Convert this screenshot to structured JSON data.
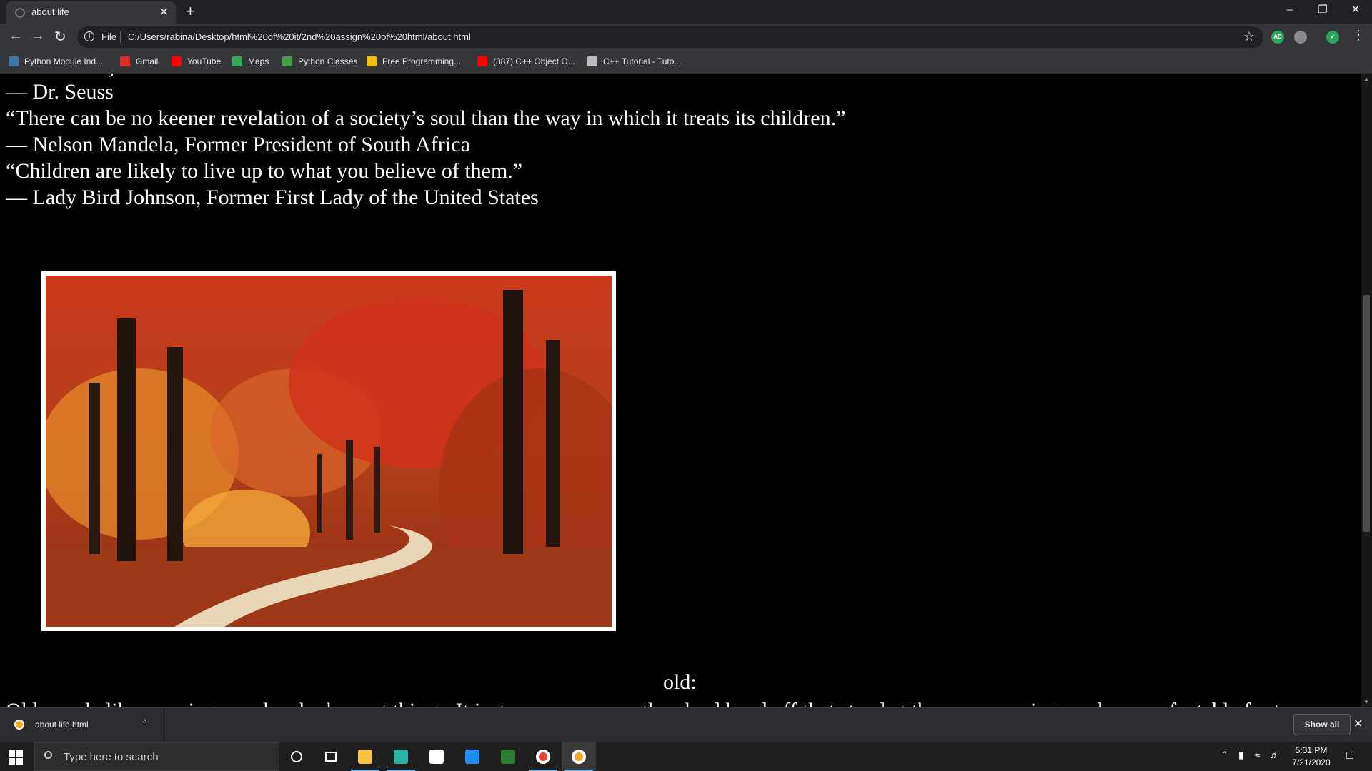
{
  "browser": {
    "tab_title": "about life",
    "new_tab_symbol": "+",
    "close_symbol": "✕",
    "scheme_label": "File",
    "url": "C:/Users/rabina/Desktop/html%20of%20it/2nd%20assign%20of%20html/about.html",
    "extensions": [
      {
        "name": "adblock-icon",
        "label": "AD",
        "color": "#2aa65c"
      },
      {
        "name": "drive-icon",
        "label": "",
        "color": "#8a8a8a"
      },
      {
        "name": "shield-check-icon",
        "label": "✓",
        "color": "#2aa65c"
      }
    ],
    "bookmarks": [
      {
        "label": "Python Module Ind...",
        "icon": "python-icon",
        "color": "#3b77a8"
      },
      {
        "label": "Gmail",
        "icon": "gmail-icon",
        "color": "#d93025"
      },
      {
        "label": "YouTube",
        "icon": "youtube-icon",
        "color": "#ff0000"
      },
      {
        "label": "Maps",
        "icon": "maps-icon",
        "color": "#34a853"
      },
      {
        "label": "Python Classes",
        "icon": "classes-icon",
        "color": "#43a047"
      },
      {
        "label": "Free Programming...",
        "icon": "letter-l-icon",
        "color": "#f2c200"
      },
      {
        "label": "(387) C++ Object O...",
        "icon": "youtube-icon",
        "color": "#ff0000"
      },
      {
        "label": "C++ Tutorial - Tuto...",
        "icon": "tutorial-icon",
        "color": "#bbbbbb"
      }
    ]
  },
  "page": {
    "quote_lines": [
      "“Adults are just outdated children.”",
      "— Dr. Seuss",
      "“There can be no keener revelation of a society’s soul than the way in which it treats its children.”",
      "— Nelson Mandela, Former President of South Africa",
      "“Children are likely to live up to what you believe of them.”",
      "— Lady Bird Johnson, Former First Lady of the United States"
    ],
    "image_subject": "autumn forest path",
    "section_heading": "old:",
    "cutoff_text": "Old people like amusing people who keep at things. It just seems as some they lead hand off that stand at the upper carriage and some of a table for t"
  },
  "downloads": {
    "file_name": "about life.html",
    "chevron": "^",
    "show_all_label": "Show all",
    "close_symbol": "✕"
  },
  "taskbar": {
    "search_placeholder": "Type here to search",
    "time": "5:31 PM",
    "date": "7/21/2020",
    "pinned": [
      {
        "name": "cortana-icon",
        "color": "#ffffff"
      },
      {
        "name": "task-view-icon",
        "color": "#ffffff"
      },
      {
        "name": "file-explorer-icon",
        "color": "#f5c242"
      },
      {
        "name": "edge-icon",
        "color": "#2bb3a6"
      },
      {
        "name": "store-icon",
        "color": "#ffffff"
      },
      {
        "name": "mail-icon",
        "color": "#1f8ef1"
      },
      {
        "name": "game-icon",
        "color": "#2e7d32"
      },
      {
        "name": "chrome-icon",
        "color": "#e94235"
      },
      {
        "name": "chrome-canary-icon",
        "color": "#f5a623"
      }
    ]
  }
}
